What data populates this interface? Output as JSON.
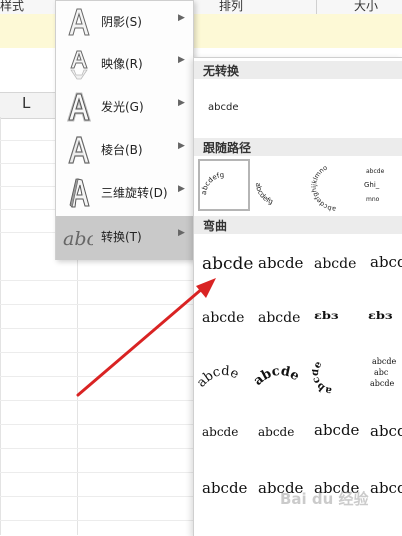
{
  "ribbon": {
    "style_label": "样式",
    "arrange_label": "排列",
    "size_label": "大小"
  },
  "sheet": {
    "column_letter": "L"
  },
  "menu": {
    "items": [
      {
        "label": "阴影(S)",
        "icon": "text-effect-A-icon"
      },
      {
        "label": "映像(R)",
        "icon": "reflection-A-icon"
      },
      {
        "label": "发光(G)",
        "icon": "glow-A-icon"
      },
      {
        "label": "棱台(B)",
        "icon": "bevel-A-icon"
      },
      {
        "label": "三维旋转(D)",
        "icon": "3d-rotation-A-icon"
      },
      {
        "label": "转换(T)",
        "icon": "transform-abc-icon",
        "active": true
      }
    ],
    "submenu_arrow": "▶"
  },
  "gallery": {
    "no_transform": {
      "title": "无转换",
      "sample": "abcde"
    },
    "follow_path": {
      "title": "跟随路径",
      "sample": "abcdefg"
    },
    "warp": {
      "title": "弯曲",
      "sample": "abcde"
    }
  },
  "watermark": "Bai du 经验",
  "colors": {
    "accent_arrow": "#d92323",
    "menu_active": "#c9c9c9"
  }
}
